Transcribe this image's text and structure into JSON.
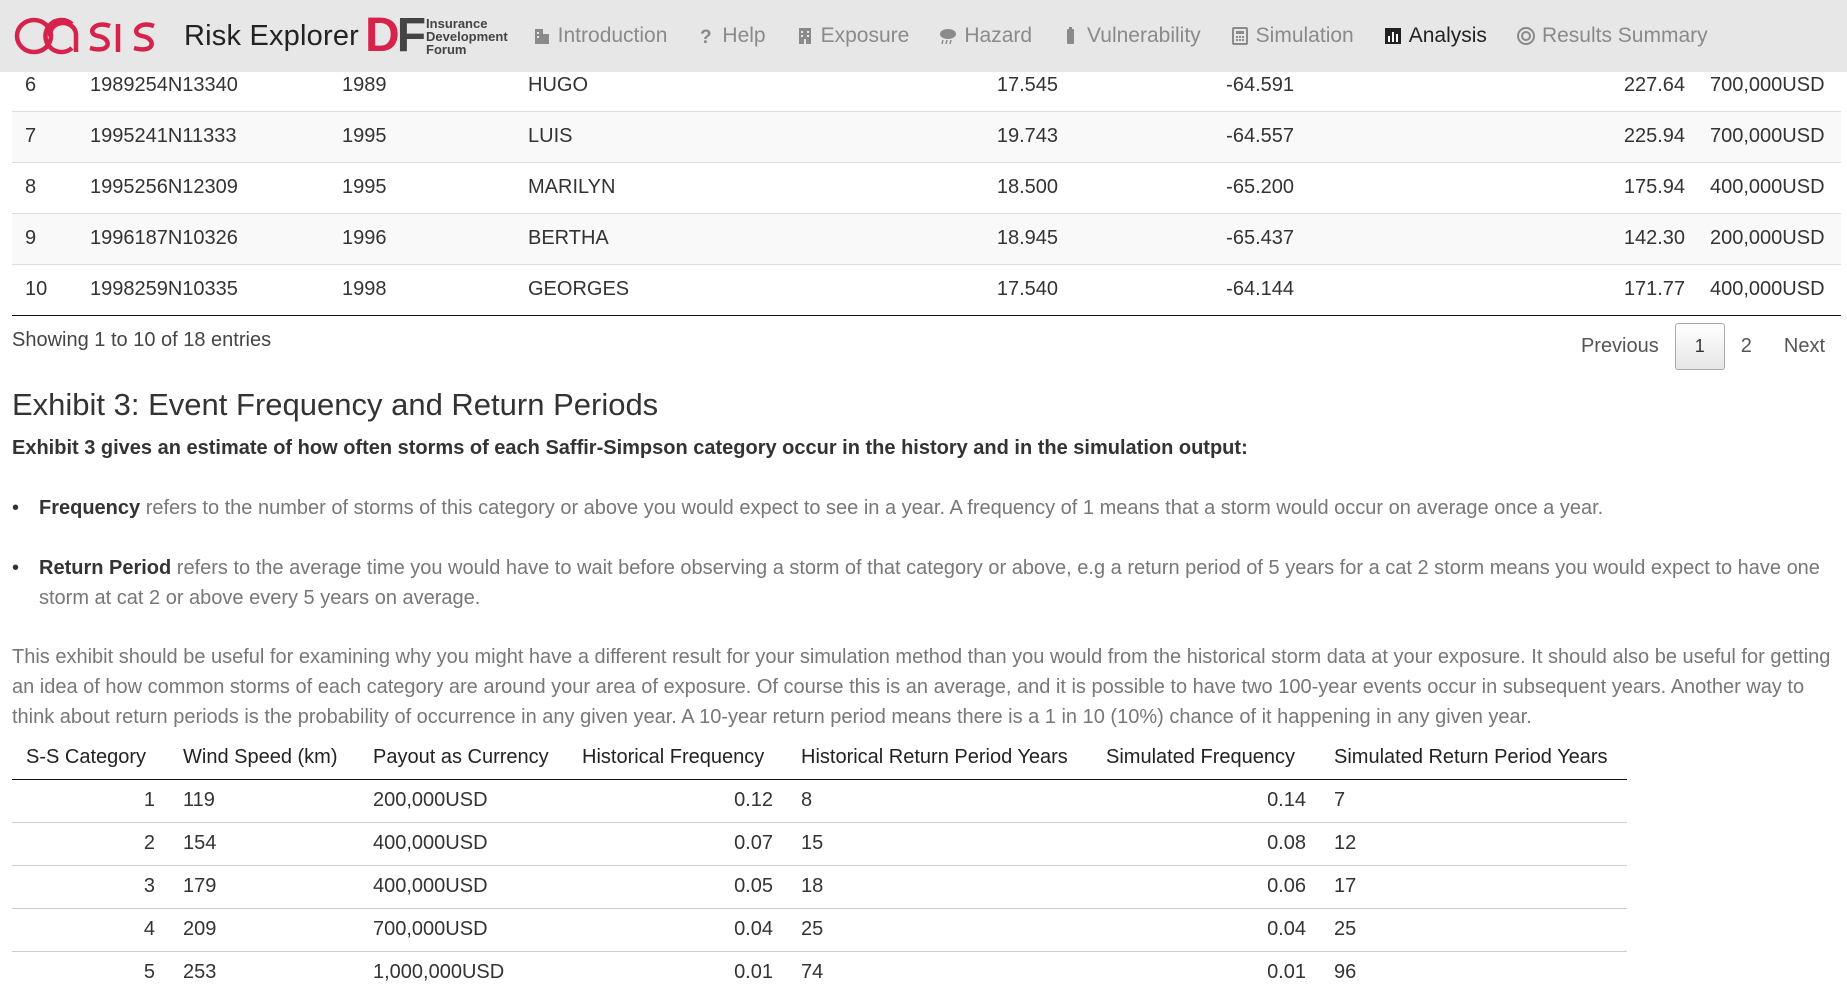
{
  "nav": {
    "brand_title": "Risk Explorer",
    "idf_mark": "DF",
    "idf_text_lines": [
      "Insurance",
      "Development",
      "Forum"
    ],
    "items": [
      {
        "label": "Introduction",
        "icon": "building-icon",
        "active": false
      },
      {
        "label": "Help",
        "icon": "question-icon",
        "active": false
      },
      {
        "label": "Exposure",
        "icon": "office-icon",
        "active": false
      },
      {
        "label": "Hazard",
        "icon": "cloud-rain-icon",
        "active": false
      },
      {
        "label": "Vulnerability",
        "icon": "battery-icon",
        "active": false
      },
      {
        "label": "Simulation",
        "icon": "calculator-icon",
        "active": false
      },
      {
        "label": "Analysis",
        "icon": "bar-chart-icon",
        "active": true
      },
      {
        "label": "Results Summary",
        "icon": "bullseye-icon",
        "active": false
      }
    ]
  },
  "events_table": {
    "rows": [
      {
        "idx": "6",
        "id": "1989254N13340",
        "year": "1989",
        "name": "HUGO",
        "lat": "17.545",
        "lon": "-64.591",
        "wind": "227.64",
        "payout": "700,000USD"
      },
      {
        "idx": "7",
        "id": "1995241N11333",
        "year": "1995",
        "name": "LUIS",
        "lat": "19.743",
        "lon": "-64.557",
        "wind": "225.94",
        "payout": "700,000USD"
      },
      {
        "idx": "8",
        "id": "1995256N12309",
        "year": "1995",
        "name": "MARILYN",
        "lat": "18.500",
        "lon": "-65.200",
        "wind": "175.94",
        "payout": "400,000USD"
      },
      {
        "idx": "9",
        "id": "1996187N10326",
        "year": "1996",
        "name": "BERTHA",
        "lat": "18.945",
        "lon": "-65.437",
        "wind": "142.30",
        "payout": "200,000USD"
      },
      {
        "idx": "10",
        "id": "1998259N10335",
        "year": "1998",
        "name": "GEORGES",
        "lat": "17.540",
        "lon": "-64.144",
        "wind": "171.77",
        "payout": "400,000USD"
      }
    ],
    "info": "Showing 1 to 10 of 18 entries",
    "pager": {
      "previous": "Previous",
      "pages": [
        "1",
        "2"
      ],
      "current": "1",
      "next": "Next"
    }
  },
  "exhibit3": {
    "title": "Exhibit 3: Event Frequency and Return Periods",
    "lead": "Exhibit 3 gives an estimate of how often storms of each Saffir-Simpson category occur in the history and in the simulation output:",
    "bullets": [
      {
        "term": "Frequency",
        "text": " refers to the number of storms of this category or above you would expect to see in a year. A frequency of 1 means that a storm would occur on average once a year."
      },
      {
        "term": "Return Period",
        "text": " refers to the average time you would have to wait before observing a storm of that category or above, e.g a return period of 5 years for a cat 2 storm means you would expect to have one storm at cat 2 or above every 5 years on average."
      }
    ],
    "paragraph": "This exhibit should be useful for examining why you might have a different result for your simulation method than you would from the historical storm data at your exposure. It should also be useful for getting an idea of how common storms of each category are around your area of exposure. Of course this is an average, and it is possible to have two 100-year events occur in subsequent years. Another way to think about return periods is the probability of occurrence in any given year. A 10-year return period means there is a 1 in 10 (10%) chance of it happening in any given year.",
    "columns": [
      "S-S Category",
      "Wind Speed (km)",
      "Payout as Currency",
      "Historical Frequency",
      "Historical Return Period Years",
      "Simulated Frequency",
      "Simulated Return Period Years"
    ],
    "rows": [
      [
        "1",
        "119",
        "200,000USD",
        "0.12",
        "8",
        "0.14",
        "7"
      ],
      [
        "2",
        "154",
        "400,000USD",
        "0.07",
        "15",
        "0.08",
        "12"
      ],
      [
        "3",
        "179",
        "400,000USD",
        "0.05",
        "18",
        "0.06",
        "17"
      ],
      [
        "4",
        "209",
        "700,000USD",
        "0.04",
        "25",
        "0.04",
        "25"
      ],
      [
        "5",
        "253",
        "1,000,000USD",
        "0.01",
        "74",
        "0.01",
        "96"
      ]
    ]
  }
}
